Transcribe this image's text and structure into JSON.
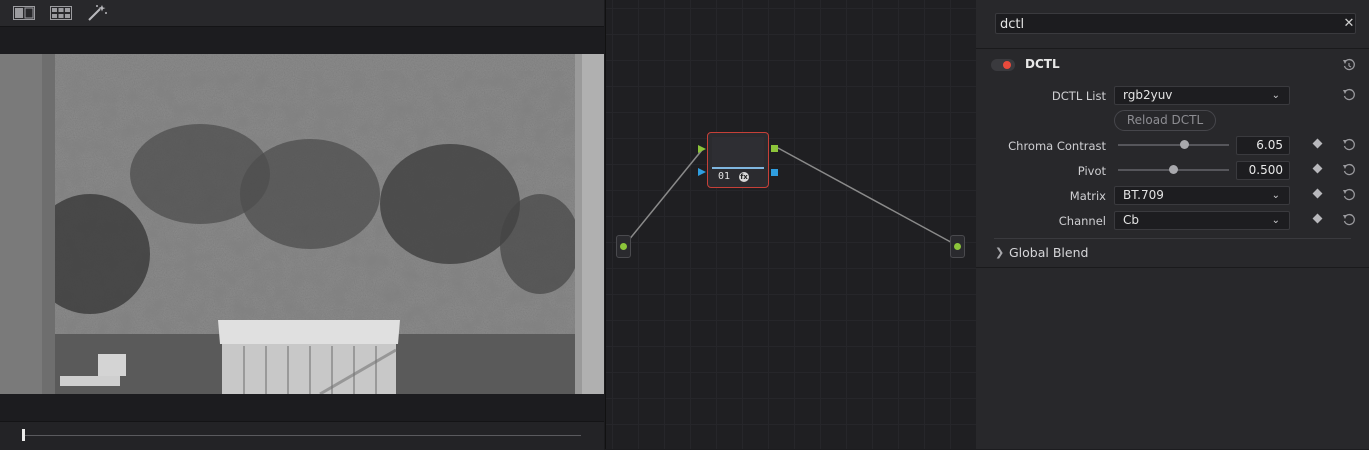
{
  "viewer": {
    "toolbar_icons": [
      "split-view-icon",
      "grid-view-icon",
      "magic-wand-icon"
    ],
    "image_description_colors": {
      "sky": "#8f8f8f",
      "trees": "#4a4a4a",
      "shed": "#d8d8d8"
    },
    "playhead_position": 0.0
  },
  "nodegraph": {
    "node": {
      "label": "01",
      "fx_glyph": "fx"
    },
    "colors": {
      "node_border": "#c64038",
      "rgb_input": "#8cc43a",
      "key_input": "#2f9ee0",
      "connector": "#8a8a8a"
    }
  },
  "inspector": {
    "search": {
      "value": "dctl",
      "clear_glyph": "✕"
    },
    "effect": {
      "title": "DCTL",
      "enabled": true
    },
    "dctl_list": {
      "label": "DCTL List",
      "value": "rgb2yuv"
    },
    "reload_button": "Reload DCTL",
    "chroma_contrast": {
      "label": "Chroma Contrast",
      "value": "6.05",
      "slider_fraction": 0.6
    },
    "pivot": {
      "label": "Pivot",
      "value": "0.500",
      "slider_fraction": 0.5
    },
    "matrix": {
      "label": "Matrix",
      "value": "BT.709"
    },
    "channel": {
      "label": "Channel",
      "value": "Cb"
    },
    "global_blend": {
      "label": "Global Blend"
    }
  }
}
